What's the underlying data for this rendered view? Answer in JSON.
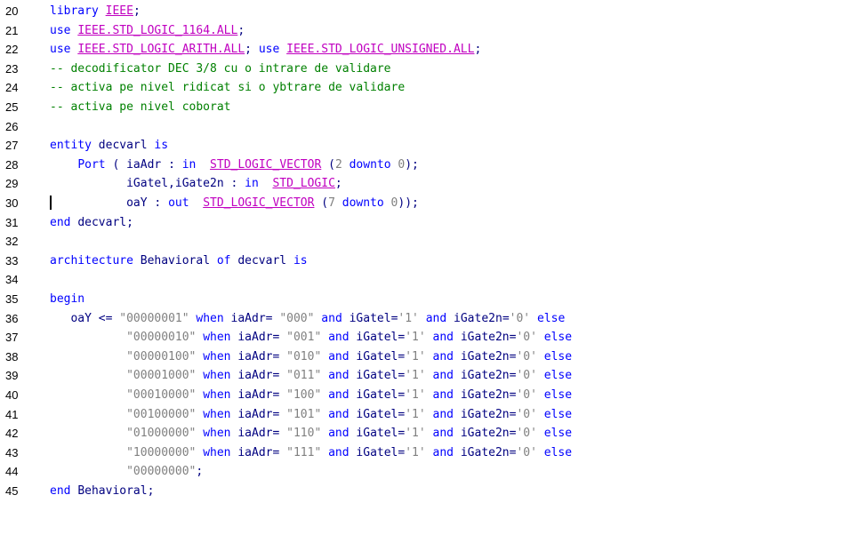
{
  "editor": {
    "lines": [
      {
        "num": "20",
        "tokens": [
          {
            "t": "kw",
            "v": "library "
          },
          {
            "t": "lib",
            "v": "IEEE"
          },
          {
            "t": "id",
            "v": ";"
          }
        ]
      },
      {
        "num": "21",
        "tokens": [
          {
            "t": "kw",
            "v": "use "
          },
          {
            "t": "lib",
            "v": "IEEE.STD_LOGIC_1164.ALL"
          },
          {
            "t": "id",
            "v": ";"
          }
        ]
      },
      {
        "num": "22",
        "tokens": [
          {
            "t": "kw",
            "v": "use "
          },
          {
            "t": "lib",
            "v": "IEEE.STD_LOGIC_ARITH.ALL"
          },
          {
            "t": "id",
            "v": "; "
          },
          {
            "t": "kw",
            "v": "use "
          },
          {
            "t": "lib",
            "v": "IEEE.STD_LOGIC_UNSIGNED.ALL"
          },
          {
            "t": "id",
            "v": ";"
          }
        ]
      },
      {
        "num": "23",
        "tokens": [
          {
            "t": "cm",
            "v": "-- decodificator DEC 3/8 cu o intrare de validare"
          }
        ]
      },
      {
        "num": "24",
        "tokens": [
          {
            "t": "cm",
            "v": "-- activa pe nivel ridicat si o ybtrare de validare"
          }
        ]
      },
      {
        "num": "25",
        "tokens": [
          {
            "t": "cm",
            "v": "-- activa pe nivel coborat"
          }
        ]
      },
      {
        "num": "26",
        "tokens": []
      },
      {
        "num": "27",
        "tokens": [
          {
            "t": "kw",
            "v": "entity "
          },
          {
            "t": "id",
            "v": "decvarl "
          },
          {
            "t": "kw",
            "v": "is"
          }
        ]
      },
      {
        "num": "28",
        "tokens": [
          {
            "t": "id",
            "v": "    "
          },
          {
            "t": "kw",
            "v": "Port "
          },
          {
            "t": "id",
            "v": "( iaAdr : "
          },
          {
            "t": "kw",
            "v": "in  "
          },
          {
            "t": "ty-u",
            "v": "STD_LOGIC_VECTOR"
          },
          {
            "t": "id",
            "v": " ("
          },
          {
            "t": "str",
            "v": "2"
          },
          {
            "t": "kw",
            "v": " downto "
          },
          {
            "t": "str",
            "v": "0"
          },
          {
            "t": "id",
            "v": ");"
          }
        ]
      },
      {
        "num": "29",
        "tokens": [
          {
            "t": "id",
            "v": "           iGatel,iGate2n : "
          },
          {
            "t": "kw",
            "v": "in  "
          },
          {
            "t": "ty-u",
            "v": "STD_LOGIC"
          },
          {
            "t": "id",
            "v": ";"
          }
        ]
      },
      {
        "num": "30",
        "caret": true,
        "tokens": [
          {
            "t": "id",
            "v": "           oaY : "
          },
          {
            "t": "kw",
            "v": "out  "
          },
          {
            "t": "ty-u",
            "v": "STD_LOGIC_VECTOR"
          },
          {
            "t": "id",
            "v": " ("
          },
          {
            "t": "str",
            "v": "7"
          },
          {
            "t": "kw",
            "v": " downto "
          },
          {
            "t": "str",
            "v": "0"
          },
          {
            "t": "id",
            "v": "));"
          }
        ]
      },
      {
        "num": "31",
        "tokens": [
          {
            "t": "kw",
            "v": "end "
          },
          {
            "t": "id",
            "v": "decvarl;"
          }
        ]
      },
      {
        "num": "32",
        "tokens": []
      },
      {
        "num": "33",
        "tokens": [
          {
            "t": "kw",
            "v": "architecture "
          },
          {
            "t": "id",
            "v": "Behavioral "
          },
          {
            "t": "kw",
            "v": "of "
          },
          {
            "t": "id",
            "v": "decvarl "
          },
          {
            "t": "kw",
            "v": "is"
          }
        ]
      },
      {
        "num": "34",
        "tokens": []
      },
      {
        "num": "35",
        "tokens": [
          {
            "t": "kw",
            "v": "begin"
          }
        ]
      },
      {
        "num": "36",
        "tokens": [
          {
            "t": "id",
            "v": "   oaY <= "
          },
          {
            "t": "str",
            "v": "\"00000001\""
          },
          {
            "t": "kw",
            "v": " when "
          },
          {
            "t": "id",
            "v": "iaAdr= "
          },
          {
            "t": "str",
            "v": "\"000\""
          },
          {
            "t": "kw",
            "v": " and "
          },
          {
            "t": "id",
            "v": "iGatel="
          },
          {
            "t": "str",
            "v": "'1'"
          },
          {
            "t": "kw",
            "v": " and "
          },
          {
            "t": "id",
            "v": "iGate2n="
          },
          {
            "t": "str",
            "v": "'0'"
          },
          {
            "t": "kw",
            "v": " else"
          }
        ]
      },
      {
        "num": "37",
        "tokens": [
          {
            "t": "id",
            "v": "           "
          },
          {
            "t": "str",
            "v": "\"00000010\""
          },
          {
            "t": "kw",
            "v": " when "
          },
          {
            "t": "id",
            "v": "iaAdr= "
          },
          {
            "t": "str",
            "v": "\"001\""
          },
          {
            "t": "kw",
            "v": " and "
          },
          {
            "t": "id",
            "v": "iGatel="
          },
          {
            "t": "str",
            "v": "'1'"
          },
          {
            "t": "kw",
            "v": " and "
          },
          {
            "t": "id",
            "v": "iGate2n="
          },
          {
            "t": "str",
            "v": "'0'"
          },
          {
            "t": "kw",
            "v": " else"
          }
        ]
      },
      {
        "num": "38",
        "tokens": [
          {
            "t": "id",
            "v": "           "
          },
          {
            "t": "str",
            "v": "\"00000100\""
          },
          {
            "t": "kw",
            "v": " when "
          },
          {
            "t": "id",
            "v": "iaAdr= "
          },
          {
            "t": "str",
            "v": "\"010\""
          },
          {
            "t": "kw",
            "v": " and "
          },
          {
            "t": "id",
            "v": "iGatel="
          },
          {
            "t": "str",
            "v": "'1'"
          },
          {
            "t": "kw",
            "v": " and "
          },
          {
            "t": "id",
            "v": "iGate2n="
          },
          {
            "t": "str",
            "v": "'0'"
          },
          {
            "t": "kw",
            "v": " else"
          }
        ]
      },
      {
        "num": "39",
        "tokens": [
          {
            "t": "id",
            "v": "           "
          },
          {
            "t": "str",
            "v": "\"00001000\""
          },
          {
            "t": "kw",
            "v": " when "
          },
          {
            "t": "id",
            "v": "iaAdr= "
          },
          {
            "t": "str",
            "v": "\"011\""
          },
          {
            "t": "kw",
            "v": " and "
          },
          {
            "t": "id",
            "v": "iGatel="
          },
          {
            "t": "str",
            "v": "'1'"
          },
          {
            "t": "kw",
            "v": " and "
          },
          {
            "t": "id",
            "v": "iGate2n="
          },
          {
            "t": "str",
            "v": "'0'"
          },
          {
            "t": "kw",
            "v": " else"
          }
        ]
      },
      {
        "num": "40",
        "tokens": [
          {
            "t": "id",
            "v": "           "
          },
          {
            "t": "str",
            "v": "\"00010000\""
          },
          {
            "t": "kw",
            "v": " when "
          },
          {
            "t": "id",
            "v": "iaAdr= "
          },
          {
            "t": "str",
            "v": "\"100\""
          },
          {
            "t": "kw",
            "v": " and "
          },
          {
            "t": "id",
            "v": "iGatel="
          },
          {
            "t": "str",
            "v": "'1'"
          },
          {
            "t": "kw",
            "v": " and "
          },
          {
            "t": "id",
            "v": "iGate2n="
          },
          {
            "t": "str",
            "v": "'0'"
          },
          {
            "t": "kw",
            "v": " else"
          }
        ]
      },
      {
        "num": "41",
        "tokens": [
          {
            "t": "id",
            "v": "           "
          },
          {
            "t": "str",
            "v": "\"00100000\""
          },
          {
            "t": "kw",
            "v": " when "
          },
          {
            "t": "id",
            "v": "iaAdr= "
          },
          {
            "t": "str",
            "v": "\"101\""
          },
          {
            "t": "kw",
            "v": " and "
          },
          {
            "t": "id",
            "v": "iGatel="
          },
          {
            "t": "str",
            "v": "'1'"
          },
          {
            "t": "kw",
            "v": " and "
          },
          {
            "t": "id",
            "v": "iGate2n="
          },
          {
            "t": "str",
            "v": "'0'"
          },
          {
            "t": "kw",
            "v": " else"
          }
        ]
      },
      {
        "num": "42",
        "tokens": [
          {
            "t": "id",
            "v": "           "
          },
          {
            "t": "str",
            "v": "\"01000000\""
          },
          {
            "t": "kw",
            "v": " when "
          },
          {
            "t": "id",
            "v": "iaAdr= "
          },
          {
            "t": "str",
            "v": "\"110\""
          },
          {
            "t": "kw",
            "v": " and "
          },
          {
            "t": "id",
            "v": "iGatel="
          },
          {
            "t": "str",
            "v": "'1'"
          },
          {
            "t": "kw",
            "v": " and "
          },
          {
            "t": "id",
            "v": "iGate2n="
          },
          {
            "t": "str",
            "v": "'0'"
          },
          {
            "t": "kw",
            "v": " else"
          }
        ]
      },
      {
        "num": "43",
        "tokens": [
          {
            "t": "id",
            "v": "           "
          },
          {
            "t": "str",
            "v": "\"10000000\""
          },
          {
            "t": "kw",
            "v": " when "
          },
          {
            "t": "id",
            "v": "iaAdr= "
          },
          {
            "t": "str",
            "v": "\"111\""
          },
          {
            "t": "kw",
            "v": " and "
          },
          {
            "t": "id",
            "v": "iGatel="
          },
          {
            "t": "str",
            "v": "'1'"
          },
          {
            "t": "kw",
            "v": " and "
          },
          {
            "t": "id",
            "v": "iGate2n="
          },
          {
            "t": "str",
            "v": "'0'"
          },
          {
            "t": "kw",
            "v": " else"
          }
        ]
      },
      {
        "num": "44",
        "tokens": [
          {
            "t": "id",
            "v": "           "
          },
          {
            "t": "str",
            "v": "\"00000000\""
          },
          {
            "t": "id",
            "v": ";"
          }
        ]
      },
      {
        "num": "45",
        "tokens": [
          {
            "t": "kw",
            "v": "end "
          },
          {
            "t": "id",
            "v": "Behavioral;"
          }
        ]
      }
    ]
  },
  "colors": {
    "keyword": "#0000ff",
    "library": "#c000c0",
    "comment": "#008000",
    "string": "#808080",
    "identifier": "#000080",
    "line_number": "#000000",
    "background": "#ffffff"
  }
}
